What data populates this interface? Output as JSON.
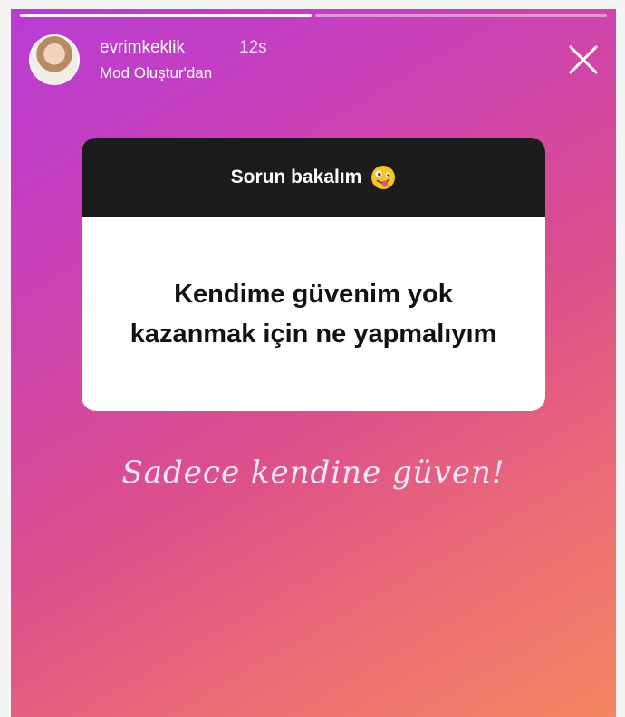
{
  "progress": {
    "segments": 2,
    "completed": 1
  },
  "header": {
    "username": "evrimkeklik",
    "time": "12s",
    "subtitle": "Mod Oluştur'dan"
  },
  "icons": {
    "avatar": "profile-avatar",
    "close": "close-icon",
    "emoji": "zany-face-emoji"
  },
  "question_card": {
    "title": "Sorun bakalım",
    "question": "Kendime güvenim yok kazanmak için ne yapmalıyım"
  },
  "answer_text": "Sadece kendine güven!"
}
